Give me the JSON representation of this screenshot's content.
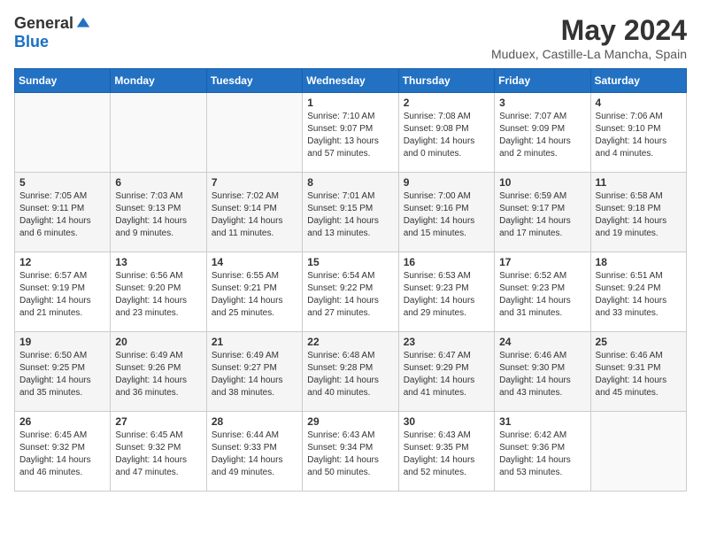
{
  "logo": {
    "general": "General",
    "blue": "Blue"
  },
  "title": "May 2024",
  "location": "Muduex, Castille-La Mancha, Spain",
  "days_of_week": [
    "Sunday",
    "Monday",
    "Tuesday",
    "Wednesday",
    "Thursday",
    "Friday",
    "Saturday"
  ],
  "weeks": [
    [
      {
        "day": "",
        "info": ""
      },
      {
        "day": "",
        "info": ""
      },
      {
        "day": "",
        "info": ""
      },
      {
        "day": "1",
        "info": "Sunrise: 7:10 AM\nSunset: 9:07 PM\nDaylight: 13 hours and 57 minutes."
      },
      {
        "day": "2",
        "info": "Sunrise: 7:08 AM\nSunset: 9:08 PM\nDaylight: 14 hours and 0 minutes."
      },
      {
        "day": "3",
        "info": "Sunrise: 7:07 AM\nSunset: 9:09 PM\nDaylight: 14 hours and 2 minutes."
      },
      {
        "day": "4",
        "info": "Sunrise: 7:06 AM\nSunset: 9:10 PM\nDaylight: 14 hours and 4 minutes."
      }
    ],
    [
      {
        "day": "5",
        "info": "Sunrise: 7:05 AM\nSunset: 9:11 PM\nDaylight: 14 hours and 6 minutes."
      },
      {
        "day": "6",
        "info": "Sunrise: 7:03 AM\nSunset: 9:13 PM\nDaylight: 14 hours and 9 minutes."
      },
      {
        "day": "7",
        "info": "Sunrise: 7:02 AM\nSunset: 9:14 PM\nDaylight: 14 hours and 11 minutes."
      },
      {
        "day": "8",
        "info": "Sunrise: 7:01 AM\nSunset: 9:15 PM\nDaylight: 14 hours and 13 minutes."
      },
      {
        "day": "9",
        "info": "Sunrise: 7:00 AM\nSunset: 9:16 PM\nDaylight: 14 hours and 15 minutes."
      },
      {
        "day": "10",
        "info": "Sunrise: 6:59 AM\nSunset: 9:17 PM\nDaylight: 14 hours and 17 minutes."
      },
      {
        "day": "11",
        "info": "Sunrise: 6:58 AM\nSunset: 9:18 PM\nDaylight: 14 hours and 19 minutes."
      }
    ],
    [
      {
        "day": "12",
        "info": "Sunrise: 6:57 AM\nSunset: 9:19 PM\nDaylight: 14 hours and 21 minutes."
      },
      {
        "day": "13",
        "info": "Sunrise: 6:56 AM\nSunset: 9:20 PM\nDaylight: 14 hours and 23 minutes."
      },
      {
        "day": "14",
        "info": "Sunrise: 6:55 AM\nSunset: 9:21 PM\nDaylight: 14 hours and 25 minutes."
      },
      {
        "day": "15",
        "info": "Sunrise: 6:54 AM\nSunset: 9:22 PM\nDaylight: 14 hours and 27 minutes."
      },
      {
        "day": "16",
        "info": "Sunrise: 6:53 AM\nSunset: 9:23 PM\nDaylight: 14 hours and 29 minutes."
      },
      {
        "day": "17",
        "info": "Sunrise: 6:52 AM\nSunset: 9:23 PM\nDaylight: 14 hours and 31 minutes."
      },
      {
        "day": "18",
        "info": "Sunrise: 6:51 AM\nSunset: 9:24 PM\nDaylight: 14 hours and 33 minutes."
      }
    ],
    [
      {
        "day": "19",
        "info": "Sunrise: 6:50 AM\nSunset: 9:25 PM\nDaylight: 14 hours and 35 minutes."
      },
      {
        "day": "20",
        "info": "Sunrise: 6:49 AM\nSunset: 9:26 PM\nDaylight: 14 hours and 36 minutes."
      },
      {
        "day": "21",
        "info": "Sunrise: 6:49 AM\nSunset: 9:27 PM\nDaylight: 14 hours and 38 minutes."
      },
      {
        "day": "22",
        "info": "Sunrise: 6:48 AM\nSunset: 9:28 PM\nDaylight: 14 hours and 40 minutes."
      },
      {
        "day": "23",
        "info": "Sunrise: 6:47 AM\nSunset: 9:29 PM\nDaylight: 14 hours and 41 minutes."
      },
      {
        "day": "24",
        "info": "Sunrise: 6:46 AM\nSunset: 9:30 PM\nDaylight: 14 hours and 43 minutes."
      },
      {
        "day": "25",
        "info": "Sunrise: 6:46 AM\nSunset: 9:31 PM\nDaylight: 14 hours and 45 minutes."
      }
    ],
    [
      {
        "day": "26",
        "info": "Sunrise: 6:45 AM\nSunset: 9:32 PM\nDaylight: 14 hours and 46 minutes."
      },
      {
        "day": "27",
        "info": "Sunrise: 6:45 AM\nSunset: 9:32 PM\nDaylight: 14 hours and 47 minutes."
      },
      {
        "day": "28",
        "info": "Sunrise: 6:44 AM\nSunset: 9:33 PM\nDaylight: 14 hours and 49 minutes."
      },
      {
        "day": "29",
        "info": "Sunrise: 6:43 AM\nSunset: 9:34 PM\nDaylight: 14 hours and 50 minutes."
      },
      {
        "day": "30",
        "info": "Sunrise: 6:43 AM\nSunset: 9:35 PM\nDaylight: 14 hours and 52 minutes."
      },
      {
        "day": "31",
        "info": "Sunrise: 6:42 AM\nSunset: 9:36 PM\nDaylight: 14 hours and 53 minutes."
      },
      {
        "day": "",
        "info": ""
      }
    ]
  ]
}
